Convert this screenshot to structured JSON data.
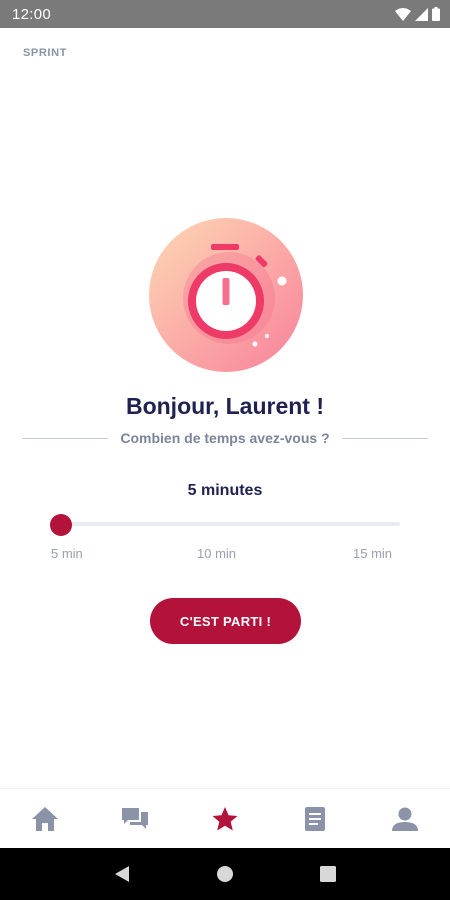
{
  "status_bar": {
    "time": "12:00"
  },
  "app": {
    "label": "SPRINT"
  },
  "greeting": "Bonjour, Laurent !",
  "question": "Combien de temps avez-vous ?",
  "duration": {
    "label": "5 minutes",
    "value_minutes": 5,
    "min_minutes": 5,
    "max_minutes": 15,
    "ticks": [
      "5 min",
      "10 min",
      "15 min"
    ]
  },
  "start_button": {
    "label": "C'EST PARTI !"
  },
  "tab_bar": {
    "items": [
      {
        "icon": "home-icon",
        "active": false
      },
      {
        "icon": "chat-icon",
        "active": false
      },
      {
        "icon": "star-icon",
        "active": true
      },
      {
        "icon": "book-icon",
        "active": false
      },
      {
        "icon": "profile-icon",
        "active": false
      }
    ]
  },
  "colors": {
    "accent": "#b3133b",
    "heading": "#1f2250",
    "muted": "#7b849b",
    "tab_inactive": "#8a93a8"
  }
}
